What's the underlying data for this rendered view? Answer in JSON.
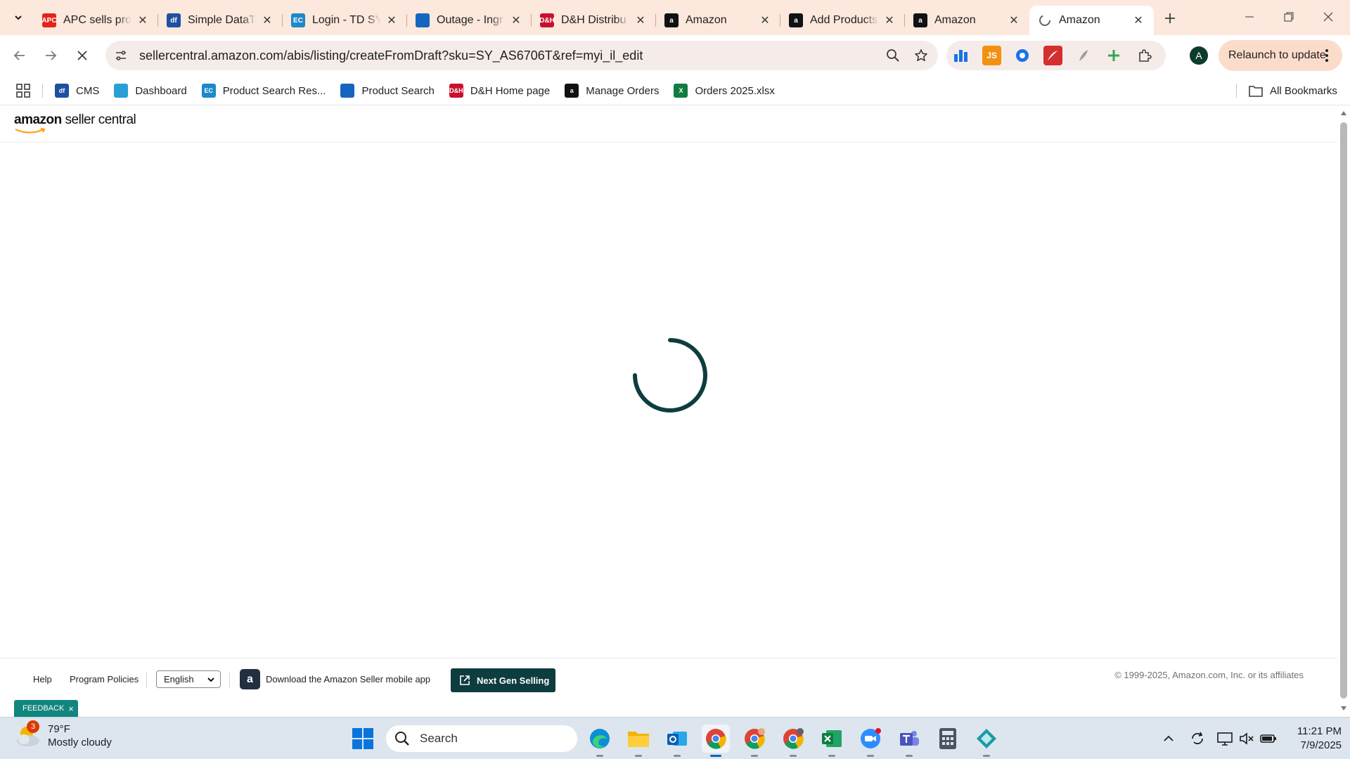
{
  "browser": {
    "tabs": [
      {
        "title": "APC sells pro",
        "favicon": "apc-logo-icon",
        "color": "#e2231a",
        "fav_text": "APC"
      },
      {
        "title": "Simple DataT",
        "favicon": "df-logo-icon",
        "color": "#1f4fa3",
        "fav_text": "df"
      },
      {
        "title": "Login - TD SY",
        "favicon": "ec-logo-icon",
        "color": "#1e88c8",
        "fav_text": "EC"
      },
      {
        "title": "Outage - Ingr",
        "favicon": "ingram-logo-icon",
        "color": "#1565c0",
        "fav_text": ""
      },
      {
        "title": "D&H Distribu",
        "favicon": "dh-logo-icon",
        "color": "#c8102e",
        "fav_text": "D&H"
      },
      {
        "title": "Amazon",
        "favicon": "amazon-logo-icon",
        "color": "#111111",
        "fav_text": "a"
      },
      {
        "title": "Add Products",
        "favicon": "amazon-logo-icon",
        "color": "#111111",
        "fav_text": "a"
      },
      {
        "title": "Amazon",
        "favicon": "amazon-logo-icon",
        "color": "#111111",
        "fav_text": "a"
      },
      {
        "title": "Amazon",
        "favicon": "loading-icon",
        "color": "#5f6368",
        "fav_text": "",
        "active": true
      }
    ],
    "url": "sellercentral.amazon.com/abis/listing/createFromDraft?sku=SY_AS6706T&ref=myi_il_edit",
    "relaunch_label": "Relaunch to update",
    "profile_initial": "A",
    "bookmarks": [
      {
        "label": "CMS",
        "favicon": "df-logo-icon",
        "color": "#1f4fa3",
        "fav_text": "df"
      },
      {
        "label": "Dashboard",
        "favicon": "dashboard-logo-icon",
        "color": "#2a9fd6",
        "fav_text": ""
      },
      {
        "label": "Product Search Res...",
        "favicon": "ec-logo-icon",
        "color": "#1e88c8",
        "fav_text": "EC"
      },
      {
        "label": "Product Search",
        "favicon": "ingram-logo-icon",
        "color": "#1565c0",
        "fav_text": ""
      },
      {
        "label": "D&H Home page",
        "favicon": "dh-logo-icon",
        "color": "#c8102e",
        "fav_text": "D&H"
      },
      {
        "label": "Manage Orders",
        "favicon": "amazon-logo-icon",
        "color": "#111111",
        "fav_text": "a"
      },
      {
        "label": "Orders 2025.xlsx",
        "favicon": "excel-icon",
        "color": "#107c41",
        "fav_text": "X"
      }
    ],
    "all_bookmarks_label": "All Bookmarks"
  },
  "page": {
    "logo_bold": "amazon",
    "logo_rest": " seller central",
    "footer": {
      "help": "Help",
      "program_policies": "Program Policies",
      "language": "English",
      "app_download": "Download the Amazon Seller mobile app",
      "next_gen": "Next Gen Selling",
      "copyright": "© 1999-2025, Amazon.com, Inc. or its affiliates"
    },
    "feedback_label": "FEEDBACK",
    "spinner_color": "#0e3d3f"
  },
  "taskbar": {
    "weather_temp": "79°F",
    "weather_desc": "Mostly cloudy",
    "weather_badge": "3",
    "search_placeholder": "Search",
    "time": "11:21 PM",
    "date": "7/9/2025"
  }
}
